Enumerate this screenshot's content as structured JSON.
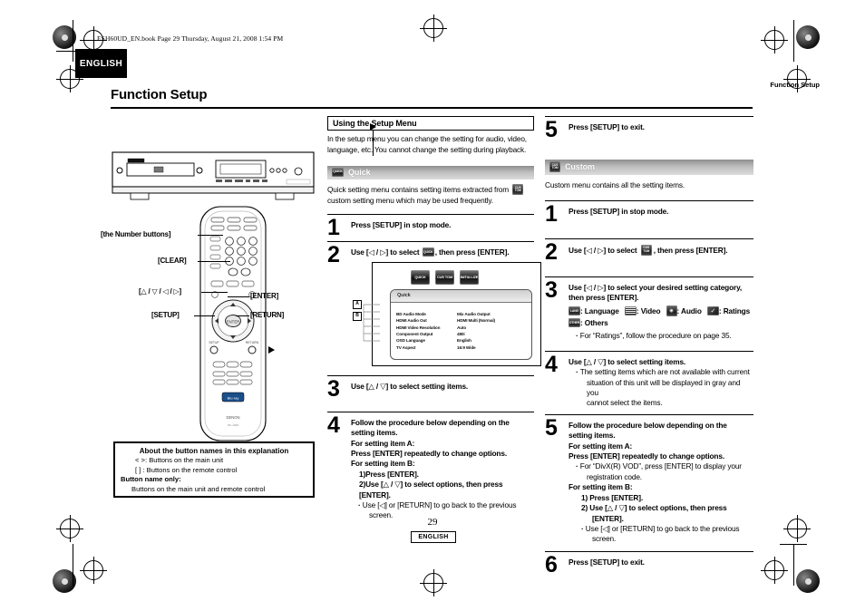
{
  "print_marks": {
    "book_line": "ESH60UD_EN.book  Page 29  Thursday, August 21, 2008  1:54 PM"
  },
  "header": {
    "language_tab": "ENGLISH",
    "running_head": "Function Setup",
    "page_title": "Function Setup"
  },
  "footer": {
    "page_number": "29",
    "language": "ENGLISH"
  },
  "left_column": {
    "remote_labels": {
      "number_buttons": "[the Number buttons]",
      "clear": "[CLEAR]",
      "cursor": "[△ / ▽ / ◁ / ▷]",
      "setup": "[SETUP]",
      "enter": "[ENTER]",
      "return": "[RETURN]"
    },
    "note_box": {
      "title": "About the button names in this explanation",
      "line1": "< >: Buttons on the main unit",
      "line2": "[  ] : Buttons on the remote control",
      "line3_bold": "Button name only:",
      "line4": "Buttons on the main unit and remote control"
    }
  },
  "middle_column": {
    "section_title": "Using the Setup Menu",
    "intro": "In the setup menu you can change the setting for audio, video, language, etc. You cannot change the setting during playback.",
    "quick_bar": {
      "label": "Quick",
      "icon": "quick-menu-icon"
    },
    "quick_intro_a": "Quick setting menu contains setting items extracted from",
    "quick_intro_b": "custom setting menu which may be used frequently.",
    "steps": [
      {
        "num": "1",
        "text": "Press [SETUP] in stop mode."
      },
      {
        "num": "2",
        "text_a": "Use [◁ / ▷] to select",
        "text_b": ", then press [ENTER]."
      },
      {
        "num": "3",
        "text": "Use [△ / ▽] to select setting items."
      },
      {
        "num": "4",
        "l1": "Follow the procedure below depending on the",
        "l2": "setting items.",
        "l3": "For setting item A:",
        "l4": "Press [ENTER] repeatedly to change options.",
        "l5": "For setting item B:",
        "l6": "1)Press [ENTER].",
        "l7": "2)Use [△ / ▽] to select options, then press [ENTER].",
        "l8": "Use [◁] or [RETURN] to go back to the previous",
        "l9": "screen."
      }
    ],
    "osd": {
      "tabs": [
        "QUICK",
        "CUS TOM",
        "INITIA LIZE"
      ],
      "panel_title": "Quick",
      "markers": [
        "A",
        "B"
      ],
      "rows": [
        {
          "name": "BD Audio Mode",
          "value": "Mix Audio Output"
        },
        {
          "name": "HDMI Audio Out",
          "value": "HDMI Multi (Normal)"
        },
        {
          "name": "HDMI Video Resolution",
          "value": "Auto"
        },
        {
          "name": "Component Output",
          "value": "480i"
        },
        {
          "name": "OSD Language",
          "value": "English"
        },
        {
          "name": "TV Aspect",
          "value": "16:9 Wide"
        }
      ]
    }
  },
  "right_column": {
    "step5_quick": {
      "num": "5",
      "text": "Press [SETUP] to exit."
    },
    "custom_bar": {
      "label": "Custom",
      "icon": "custom-menu-icon"
    },
    "custom_intro": "Custom menu contains all the setting items.",
    "steps": [
      {
        "num": "1",
        "text": "Press [SETUP] in stop mode."
      },
      {
        "num": "2",
        "text_a": "Use [◁ / ▷] to select",
        "text_b": ", then press [ENTER]."
      },
      {
        "num": "3",
        "l1": "Use [◁ / ▷] to select your desired setting category,",
        "l2": "then press [ENTER].",
        "cats": [
          ": Language",
          ": Video",
          ": Audio",
          ": Ratings",
          ": Others"
        ],
        "note": "For “Ratings”, follow the procedure on page 35."
      },
      {
        "num": "4",
        "l1": "Use [△ / ▽] to select setting items.",
        "b1": "The setting items which are not available with current",
        "b2": "situation of this unit will be displayed in gray and you",
        "b3": "cannot select the items."
      },
      {
        "num": "5",
        "l1": "Follow the procedure below depending on the",
        "l2": "setting items.",
        "l3": "For setting item A:",
        "l4": "Press [ENTER] repeatedly to change options.",
        "b1": "For “DivX(R) VOD”, press [ENTER] to display your",
        "b2": "registration code.",
        "l5": "For setting item B:",
        "l6": "1)  Press [ENTER].",
        "l7": "2)  Use [△ / ▽] to select options, then press",
        "l8": "[ENTER].",
        "b3": "Use [◁] or [RETURN] to go back to the previous",
        "b4": "screen."
      },
      {
        "num": "6",
        "text": "Press [SETUP] to exit."
      }
    ]
  }
}
